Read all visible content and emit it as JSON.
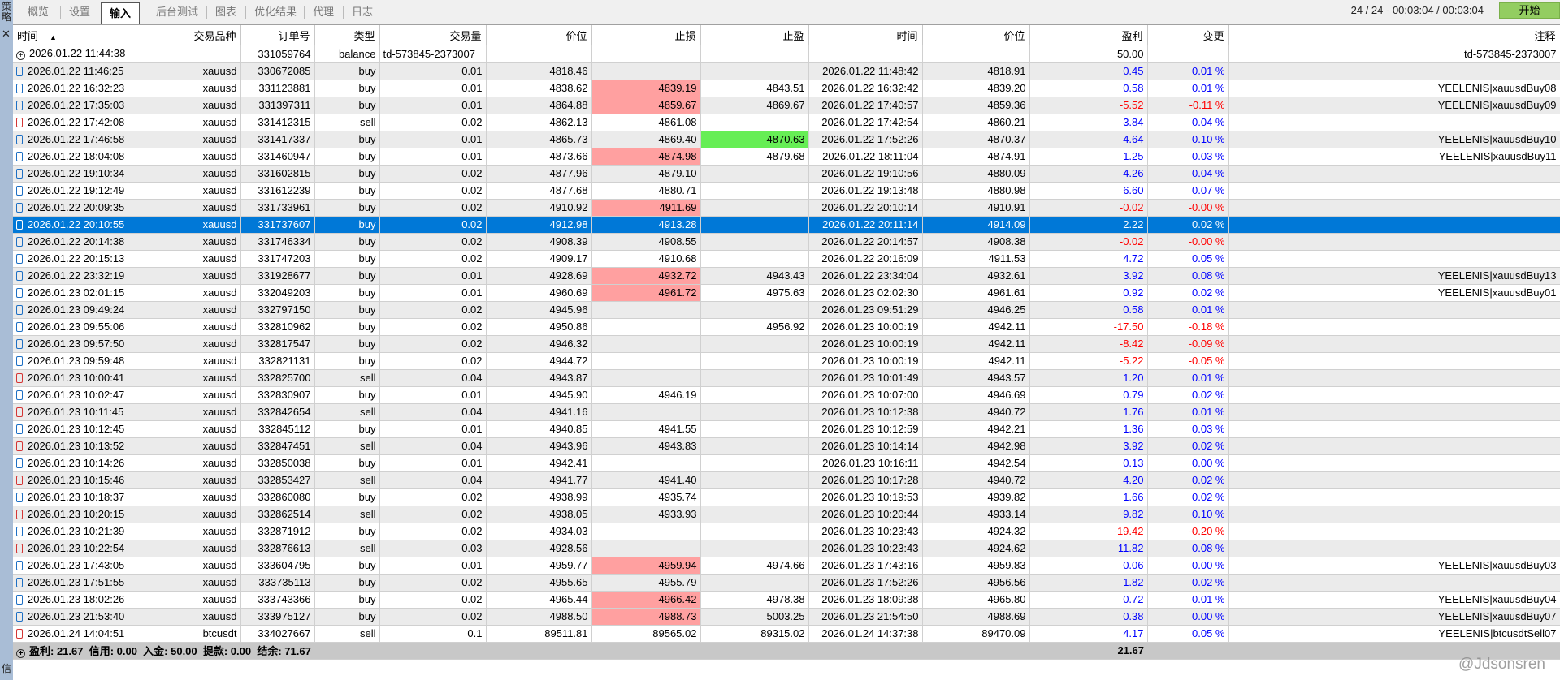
{
  "side": {
    "top_label": "策略",
    "bottom_label": "信",
    "close": "✕"
  },
  "tabs": [
    "概览",
    "设置",
    "输入",
    "后台测试",
    "图表",
    "优化结果",
    "代理",
    "日志"
  ],
  "active_tab": 2,
  "status": "24 / 24  -  00:03:04 / 00:03:04",
  "start_button": "开始",
  "columns": [
    "时间",
    "交易品种",
    "订单号",
    "类型",
    "交易量",
    "价位",
    "止损",
    "止盈",
    "时间",
    "价位",
    "盈利",
    "变更",
    "注释"
  ],
  "sort_indicator": "▲",
  "balance_row": {
    "time": "2026.01.22 11:44:38",
    "order": "331059764",
    "type": "balance",
    "desc": "td-573845-2373007",
    "profit": "50.00",
    "comment": "td-573845-2373007"
  },
  "rows": [
    [
      "2026.01.22 11:46:25",
      "xauusd",
      "330672085",
      "buy",
      "0.01",
      "4818.46",
      "",
      "",
      "2026.01.22 11:48:42",
      "4818.91",
      "0.45",
      "0.01 %",
      ""
    ],
    [
      "2026.01.22 16:32:23",
      "xauusd",
      "331123881",
      "buy",
      "0.01",
      "4838.62",
      "4839.19",
      "4843.51",
      "2026.01.22 16:32:42",
      "4839.20",
      "0.58",
      "0.01 %",
      "YEELENIS|xauusdBuy08"
    ],
    [
      "2026.01.22 17:35:03",
      "xauusd",
      "331397311",
      "buy",
      "0.01",
      "4864.88",
      "4859.67",
      "4869.67",
      "2026.01.22 17:40:57",
      "4859.36",
      "-5.52",
      "-0.11 %",
      "YEELENIS|xauusdBuy09"
    ],
    [
      "2026.01.22 17:42:08",
      "xauusd",
      "331412315",
      "sell",
      "0.02",
      "4862.13",
      "4861.08",
      "",
      "2026.01.22 17:42:54",
      "4860.21",
      "3.84",
      "0.04 %",
      ""
    ],
    [
      "2026.01.22 17:46:58",
      "xauusd",
      "331417337",
      "buy",
      "0.01",
      "4865.73",
      "4869.40",
      "4870.63",
      "2026.01.22 17:52:26",
      "4870.37",
      "4.64",
      "0.10 %",
      "YEELENIS|xauusdBuy10"
    ],
    [
      "2026.01.22 18:04:08",
      "xauusd",
      "331460947",
      "buy",
      "0.01",
      "4873.66",
      "4874.98",
      "4879.68",
      "2026.01.22 18:11:04",
      "4874.91",
      "1.25",
      "0.03 %",
      "YEELENIS|xauusdBuy11"
    ],
    [
      "2026.01.22 19:10:34",
      "xauusd",
      "331602815",
      "buy",
      "0.02",
      "4877.96",
      "4879.10",
      "",
      "2026.01.22 19:10:56",
      "4880.09",
      "4.26",
      "0.04 %",
      ""
    ],
    [
      "2026.01.22 19:12:49",
      "xauusd",
      "331612239",
      "buy",
      "0.02",
      "4877.68",
      "4880.71",
      "",
      "2026.01.22 19:13:48",
      "4880.98",
      "6.60",
      "0.07 %",
      ""
    ],
    [
      "2026.01.22 20:09:35",
      "xauusd",
      "331733961",
      "buy",
      "0.02",
      "4910.92",
      "4911.69",
      "",
      "2026.01.22 20:10:14",
      "4910.91",
      "-0.02",
      "-0.00 %",
      ""
    ],
    [
      "2026.01.22 20:10:55",
      "xauusd",
      "331737607",
      "buy",
      "0.02",
      "4912.98",
      "4913.28",
      "",
      "2026.01.22 20:11:14",
      "4914.09",
      "2.22",
      "0.02 %",
      ""
    ],
    [
      "2026.01.22 20:14:38",
      "xauusd",
      "331746334",
      "buy",
      "0.02",
      "4908.39",
      "4908.55",
      "",
      "2026.01.22 20:14:57",
      "4908.38",
      "-0.02",
      "-0.00 %",
      ""
    ],
    [
      "2026.01.22 20:15:13",
      "xauusd",
      "331747203",
      "buy",
      "0.02",
      "4909.17",
      "4910.68",
      "",
      "2026.01.22 20:16:09",
      "4911.53",
      "4.72",
      "0.05 %",
      ""
    ],
    [
      "2026.01.22 23:32:19",
      "xauusd",
      "331928677",
      "buy",
      "0.01",
      "4928.69",
      "4932.72",
      "4943.43",
      "2026.01.22 23:34:04",
      "4932.61",
      "3.92",
      "0.08 %",
      "YEELENIS|xauusdBuy13"
    ],
    [
      "2026.01.23 02:01:15",
      "xauusd",
      "332049203",
      "buy",
      "0.01",
      "4960.69",
      "4961.72",
      "4975.63",
      "2026.01.23 02:02:30",
      "4961.61",
      "0.92",
      "0.02 %",
      "YEELENIS|xauusdBuy01"
    ],
    [
      "2026.01.23 09:49:24",
      "xauusd",
      "332797150",
      "buy",
      "0.02",
      "4945.96",
      "",
      "",
      "2026.01.23 09:51:29",
      "4946.25",
      "0.58",
      "0.01 %",
      ""
    ],
    [
      "2026.01.23 09:55:06",
      "xauusd",
      "332810962",
      "buy",
      "0.02",
      "4950.86",
      "",
      "4956.92",
      "2026.01.23 10:00:19",
      "4942.11",
      "-17.50",
      "-0.18 %",
      ""
    ],
    [
      "2026.01.23 09:57:50",
      "xauusd",
      "332817547",
      "buy",
      "0.02",
      "4946.32",
      "",
      "",
      "2026.01.23 10:00:19",
      "4942.11",
      "-8.42",
      "-0.09 %",
      ""
    ],
    [
      "2026.01.23 09:59:48",
      "xauusd",
      "332821131",
      "buy",
      "0.02",
      "4944.72",
      "",
      "",
      "2026.01.23 10:00:19",
      "4942.11",
      "-5.22",
      "-0.05 %",
      ""
    ],
    [
      "2026.01.23 10:00:41",
      "xauusd",
      "332825700",
      "sell",
      "0.04",
      "4943.87",
      "",
      "",
      "2026.01.23 10:01:49",
      "4943.57",
      "1.20",
      "0.01 %",
      ""
    ],
    [
      "2026.01.23 10:02:47",
      "xauusd",
      "332830907",
      "buy",
      "0.01",
      "4945.90",
      "4946.19",
      "",
      "2026.01.23 10:07:00",
      "4946.69",
      "0.79",
      "0.02 %",
      ""
    ],
    [
      "2026.01.23 10:11:45",
      "xauusd",
      "332842654",
      "sell",
      "0.04",
      "4941.16",
      "",
      "",
      "2026.01.23 10:12:38",
      "4940.72",
      "1.76",
      "0.01 %",
      ""
    ],
    [
      "2026.01.23 10:12:45",
      "xauusd",
      "332845112",
      "buy",
      "0.01",
      "4940.85",
      "4941.55",
      "",
      "2026.01.23 10:12:59",
      "4942.21",
      "1.36",
      "0.03 %",
      ""
    ],
    [
      "2026.01.23 10:13:52",
      "xauusd",
      "332847451",
      "sell",
      "0.04",
      "4943.96",
      "4943.83",
      "",
      "2026.01.23 10:14:14",
      "4942.98",
      "3.92",
      "0.02 %",
      ""
    ],
    [
      "2026.01.23 10:14:26",
      "xauusd",
      "332850038",
      "buy",
      "0.01",
      "4942.41",
      "",
      "",
      "2026.01.23 10:16:11",
      "4942.54",
      "0.13",
      "0.00 %",
      ""
    ],
    [
      "2026.01.23 10:15:46",
      "xauusd",
      "332853427",
      "sell",
      "0.04",
      "4941.77",
      "4941.40",
      "",
      "2026.01.23 10:17:28",
      "4940.72",
      "4.20",
      "0.02 %",
      ""
    ],
    [
      "2026.01.23 10:18:37",
      "xauusd",
      "332860080",
      "buy",
      "0.02",
      "4938.99",
      "4935.74",
      "",
      "2026.01.23 10:19:53",
      "4939.82",
      "1.66",
      "0.02 %",
      ""
    ],
    [
      "2026.01.23 10:20:15",
      "xauusd",
      "332862514",
      "sell",
      "0.02",
      "4938.05",
      "4933.93",
      "",
      "2026.01.23 10:20:44",
      "4933.14",
      "9.82",
      "0.10 %",
      ""
    ],
    [
      "2026.01.23 10:21:39",
      "xauusd",
      "332871912",
      "buy",
      "0.02",
      "4934.03",
      "",
      "",
      "2026.01.23 10:23:43",
      "4924.32",
      "-19.42",
      "-0.20 %",
      ""
    ],
    [
      "2026.01.23 10:22:54",
      "xauusd",
      "332876613",
      "sell",
      "0.03",
      "4928.56",
      "",
      "",
      "2026.01.23 10:23:43",
      "4924.62",
      "11.82",
      "0.08 %",
      ""
    ],
    [
      "2026.01.23 17:43:05",
      "xauusd",
      "333604795",
      "buy",
      "0.01",
      "4959.77",
      "4959.94",
      "4974.66",
      "2026.01.23 17:43:16",
      "4959.83",
      "0.06",
      "0.00 %",
      "YEELENIS|xauusdBuy03"
    ],
    [
      "2026.01.23 17:51:55",
      "xauusd",
      "333735113",
      "buy",
      "0.02",
      "4955.65",
      "4955.79",
      "",
      "2026.01.23 17:52:26",
      "4956.56",
      "1.82",
      "0.02 %",
      ""
    ],
    [
      "2026.01.23 18:02:26",
      "xauusd",
      "333743366",
      "buy",
      "0.02",
      "4965.44",
      "4966.42",
      "4978.38",
      "2026.01.23 18:09:38",
      "4965.80",
      "0.72",
      "0.01 %",
      "YEELENIS|xauusdBuy04"
    ],
    [
      "2026.01.23 21:53:40",
      "xauusd",
      "333975127",
      "buy",
      "0.02",
      "4988.50",
      "4988.73",
      "5003.25",
      "2026.01.23 21:54:50",
      "4988.69",
      "0.38",
      "0.00 %",
      "YEELENIS|xauusdBuy07"
    ],
    [
      "2026.01.24 14:04:51",
      "btcusdt",
      "334027667",
      "sell",
      "0.1",
      "89511.81",
      "89565.02",
      "89315.02",
      "2026.01.24 14:37:38",
      "89470.09",
      "4.17",
      "0.05 %",
      "YEELENIS|btcusdtSell07"
    ]
  ],
  "sl_highlight_rows": [
    1,
    2,
    5,
    8,
    12,
    13,
    29,
    31,
    32
  ],
  "tp_highlight_rows": [
    4
  ],
  "selected_row": 9,
  "footer": {
    "summary": "盈利: 21.67  信用: 0.00  入金: 50.00  提款: 0.00  结余: 71.67",
    "profit": "21.67"
  },
  "watermark": "@Jdsonsren",
  "colors": {
    "selected": "#0078d7",
    "sl_highlight": "#ffa0a0",
    "tp_highlight": "#66ee55",
    "positive": "#0000ff",
    "negative": "#ff0000",
    "start": "#93cd61"
  }
}
